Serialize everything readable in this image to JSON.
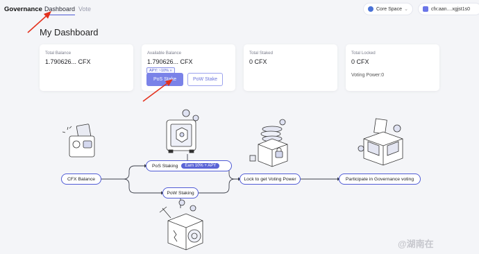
{
  "header": {
    "brand": "Governance",
    "tabs": [
      {
        "label": "Dashboard",
        "active": true
      },
      {
        "label": "Vote",
        "active": false
      }
    ],
    "network": "Core Space",
    "account": "cfx:aan....xgjst1s0"
  },
  "page": {
    "title": "My Dashboard"
  },
  "cards": [
    {
      "label": "Total Balance",
      "value": "1.790626... CFX"
    },
    {
      "label": "Available Balance",
      "value": "1.790626... CFX",
      "apy_tag": "APY: ~10% »",
      "pos_button": "PoS Stake",
      "pow_button": "PoW Stake"
    },
    {
      "label": "Total Staked",
      "value": "0 CFX"
    },
    {
      "label": "Total Locked",
      "value": "0 CFX",
      "extra": "Voting Power:0"
    }
  ],
  "flow": {
    "balance": "CFX Balance",
    "pos": "PoS Staking",
    "earn": "Earn 10% + APY",
    "pow": "PoW Staking",
    "lock": "Lock to get Voting Power",
    "govern": "Participate in Governance voting"
  },
  "colors": {
    "accent": "#4f5bd5",
    "button": "#7a82e8",
    "arrow": "#e4321e"
  },
  "watermark": "@湖南在"
}
